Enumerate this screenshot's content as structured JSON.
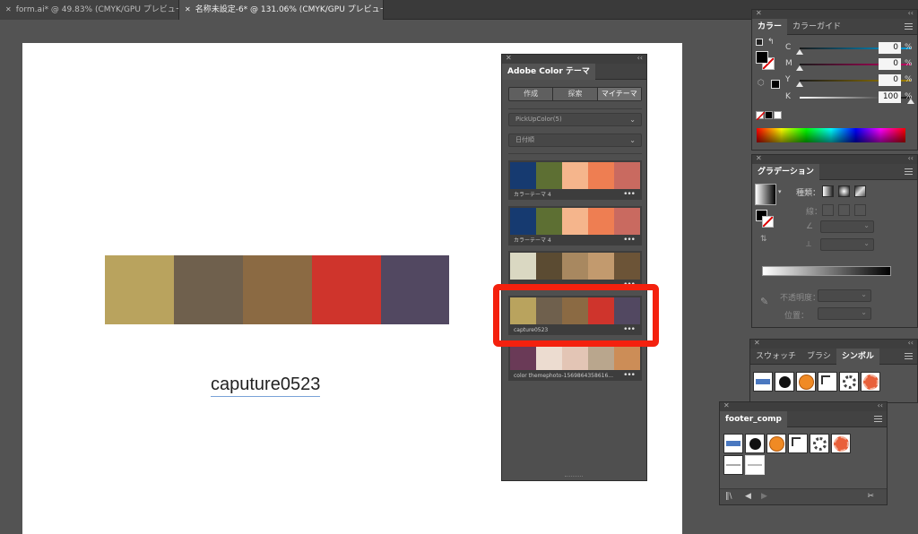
{
  "doc_tabs": [
    {
      "label": "form.ai* @ 49.83% (CMYK/GPU プレビュー)",
      "active": false
    },
    {
      "label": "名称未設定-6* @ 131.06% (CMYK/GPU プレビュー)",
      "active": true
    }
  ],
  "artboard": {
    "swatches": [
      "#b9a35e",
      "#6f604d",
      "#8b6a43",
      "#cf342c",
      "#524861"
    ],
    "caption": "caputure0523"
  },
  "color_theme_panel": {
    "title": "Adobe Color テーマ",
    "segments": [
      "作成",
      "探索",
      "マイテーマ"
    ],
    "active_segment": "マイテーマ",
    "library_dropdown": "PickUpColor(5)",
    "sort_dropdown": "日付順",
    "more_label": "•••",
    "themes": [
      {
        "name": "カラーテーマ 4",
        "colors": [
          "#163a70",
          "#5d6f33",
          "#f5b58c",
          "#ee7e52",
          "#c96a60"
        ]
      },
      {
        "name": "カラーテーマ 4",
        "colors": [
          "#163a70",
          "#5d6f33",
          "#f5b58c",
          "#ee7e52",
          "#c96a60"
        ]
      },
      {
        "name": "",
        "colors": [
          "#dad8c2",
          "#5b4b32",
          "#a88860",
          "#c29a6e",
          "#6c5437"
        ]
      },
      {
        "name": "capture0523",
        "colors": [
          "#b9a35e",
          "#6f604d",
          "#8b6a43",
          "#cf342c",
          "#524861"
        ]
      },
      {
        "name": "color themephoto-1569864358616...",
        "colors": [
          "#6a3a57",
          "#ecdcd0",
          "#e3c5b5",
          "#b9a68d",
          "#cc8d57"
        ]
      }
    ],
    "highlight_color": "#f4210e"
  },
  "color_panel": {
    "tabs": [
      "カラー",
      "カラーガイド"
    ],
    "active_tab": "カラー",
    "sliders": [
      {
        "label": "C",
        "value": "0",
        "fraction": 0.0
      },
      {
        "label": "M",
        "value": "0",
        "fraction": 0.0
      },
      {
        "label": "Y",
        "value": "0",
        "fraction": 0.0
      },
      {
        "label": "K",
        "value": "100",
        "fraction": 1.0
      }
    ],
    "percent_sign": "%"
  },
  "gradient_panel": {
    "tab": "グラデーション",
    "type_label": "種類：",
    "stroke_label": "線：",
    "opacity_label": "不透明度：",
    "location_label": "位置："
  },
  "symbol_panel": {
    "tabs": [
      "スウォッチ",
      "ブラシ",
      "シンボル"
    ],
    "active_tab": "シンボル"
  },
  "footer_panel": {
    "title": "footer_comp"
  }
}
